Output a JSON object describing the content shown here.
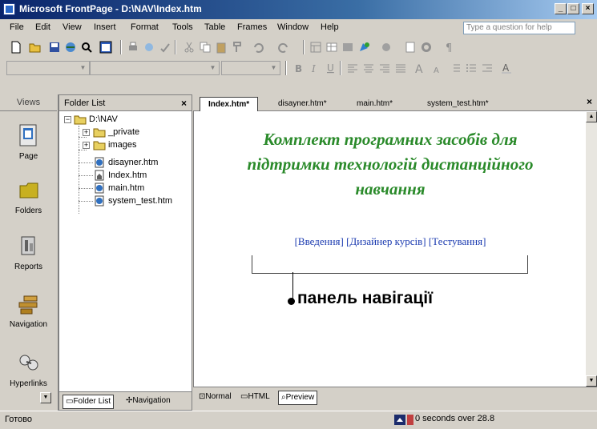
{
  "window": {
    "title": "Microsoft FrontPage - D:\\NAV\\Index.htm",
    "controls": [
      "_",
      "□",
      "×"
    ]
  },
  "menubar": {
    "items": [
      {
        "label": "File",
        "name": "menu-file"
      },
      {
        "label": "Edit",
        "name": "menu-edit"
      },
      {
        "label": "View",
        "name": "menu-view"
      },
      {
        "label": "Insert",
        "name": "menu-insert"
      },
      {
        "label": "Format",
        "name": "menu-format"
      },
      {
        "label": "Tools",
        "name": "menu-tools"
      },
      {
        "label": "Table",
        "name": "menu-table"
      },
      {
        "label": "Frames",
        "name": "menu-frames"
      },
      {
        "label": "Window",
        "name": "menu-window"
      },
      {
        "label": "Help",
        "name": "menu-help"
      }
    ],
    "ask_placeholder": "Type a question for help"
  },
  "views_panel": {
    "header": "Views",
    "items": [
      {
        "label": "Page",
        "icon": "page-view-icon"
      },
      {
        "label": "Folders",
        "icon": "folders-view-icon"
      },
      {
        "label": "Reports",
        "icon": "reports-view-icon"
      },
      {
        "label": "Navigation",
        "icon": "navigation-view-icon"
      },
      {
        "label": "Hyperlinks",
        "icon": "hyperlinks-view-icon"
      }
    ]
  },
  "folder_list": {
    "header": "Folder List",
    "close": "×",
    "root": "D:\\NAV",
    "items": [
      {
        "label": "_private",
        "type": "folder"
      },
      {
        "label": "images",
        "type": "folder"
      },
      {
        "label": "disayner.htm",
        "type": "file"
      },
      {
        "label": "Index.htm",
        "type": "file"
      },
      {
        "label": "main.htm",
        "type": "file"
      },
      {
        "label": "system_test.htm",
        "type": "file"
      }
    ],
    "footer_tabs": [
      "Folder List",
      "Navigation"
    ]
  },
  "editor": {
    "tabs": [
      "Index.htm*",
      "disayner.htm*",
      "main.htm*",
      "system_test.htm*"
    ],
    "close": "×",
    "heading_lines": [
      "Комплект програмних засобів для",
      "підтримки технологій дистанційного",
      "навчання"
    ],
    "nav_links": [
      "[Введення]",
      "[Дизайнер курсів]",
      "[Тестування]"
    ],
    "callout": "панель навігації",
    "view_tabs": [
      "Normal",
      "HTML",
      "Preview"
    ]
  },
  "status": {
    "left": "Готово",
    "download": "0 seconds over 28.8"
  },
  "colors": {
    "title_start": "#0a246a",
    "title_end": "#a6caf0",
    "heading_green": "#2a8a2a",
    "link_blue": "#1a3ab0",
    "chrome": "#d4d0c8"
  }
}
